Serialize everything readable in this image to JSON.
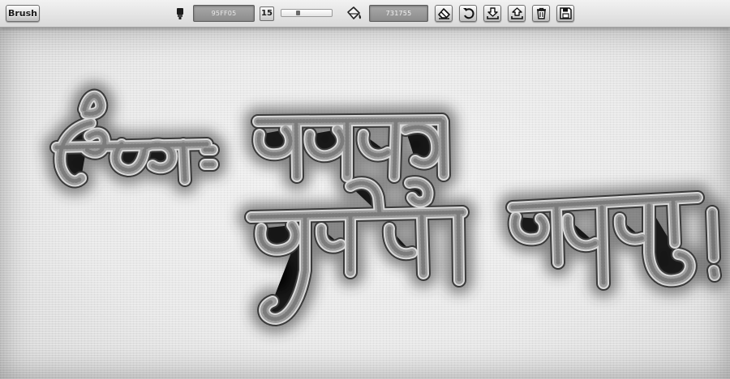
{
  "toolbar": {
    "brush_label": "Brush",
    "brush_color_hex": "95FF05",
    "brush_size": "15",
    "brush_size_fraction": 0.3,
    "background_color_hex": "731755"
  },
  "icons": {
    "brush_color": "paint-tube-icon",
    "background_color": "paint-bucket-icon",
    "eraser": "eraser-icon",
    "undo": "undo-icon",
    "save": "download-icon",
    "load": "upload-icon",
    "clear": "trash-icon",
    "save_disk": "floppy-icon"
  },
  "canvas": {
    "drawing_text": "लोकाः समस्ता सुखिनो भवन्तु!"
  }
}
